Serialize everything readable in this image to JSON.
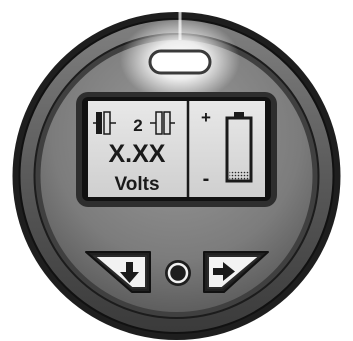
{
  "indicator": {
    "state": "on",
    "color": "#ffffff"
  },
  "display": {
    "battery_number": "2",
    "value": "X.XX",
    "unit": "Volts",
    "plus_sign": "+",
    "minus_sign": "-",
    "battery_fill_level": 0.15,
    "background_color": "#dedede"
  },
  "buttons": {
    "down_icon": "down-arrow-icon",
    "right_icon": "right-arrow-icon",
    "center_icon": "ring-icon"
  },
  "colors": {
    "bezel_outer": "#2b2b2b",
    "bezel_inner": "#6e6e6e",
    "face": "#8c8c8c",
    "lcd": "#dedede"
  }
}
